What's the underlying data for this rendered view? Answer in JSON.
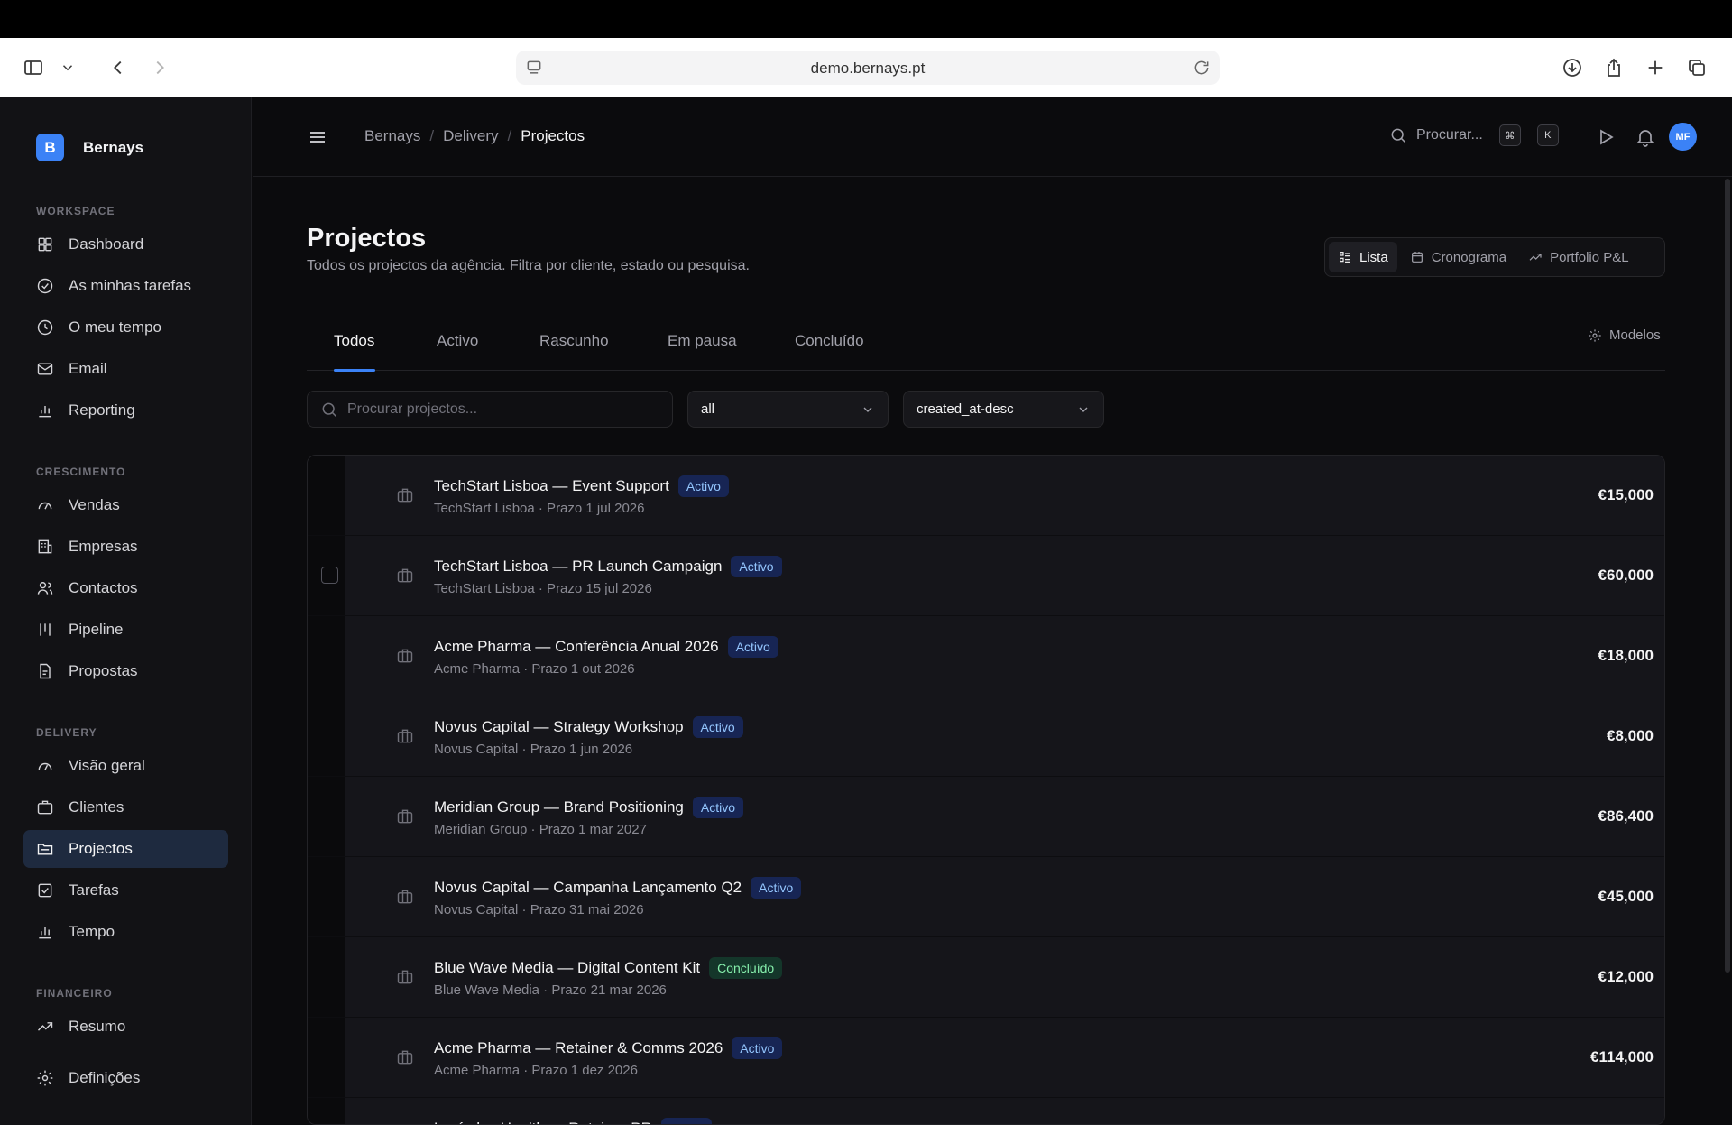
{
  "browser": {
    "url": "demo.bernays.pt"
  },
  "app": {
    "name": "Bernays",
    "logo_letter": "B",
    "avatar_initials": "MF"
  },
  "sidebar": {
    "sections": [
      {
        "title": "WORKSPACE",
        "items": [
          "Dashboard",
          "As minhas tarefas",
          "O meu tempo",
          "Email",
          "Reporting"
        ]
      },
      {
        "title": "CRESCIMENTO",
        "items": [
          "Vendas",
          "Empresas",
          "Contactos",
          "Pipeline",
          "Propostas"
        ]
      },
      {
        "title": "DELIVERY",
        "items": [
          "Visão geral",
          "Clientes",
          "Projectos",
          "Tarefas",
          "Tempo"
        ]
      },
      {
        "title": "FINANCEIRO",
        "items": [
          "Resumo",
          "Definições"
        ]
      }
    ],
    "active": "Projectos"
  },
  "topbar": {
    "breadcrumb": [
      "Bernays",
      "Delivery",
      "Projectos"
    ],
    "search_label": "Procurar...",
    "kbd1": "⌘",
    "kbd2": "K"
  },
  "page": {
    "title": "Projectos",
    "subtitle": "Todos os projectos da agência. Filtra por cliente, estado ou pesquisa.",
    "views": [
      "Lista",
      "Cronograma",
      "Portfolio P&L"
    ],
    "active_view": "Lista",
    "tabs": [
      "Todos",
      "Activo",
      "Rascunho",
      "Em pausa",
      "Concluído"
    ],
    "active_tab": "Todos",
    "models_label": "Modelos",
    "search_placeholder": "Procurar projectos...",
    "filter_status": "all",
    "sort": "created_at-desc"
  },
  "projects": [
    {
      "title": "TechStart Lisboa — Event Support",
      "status": "Activo",
      "meta": "TechStart Lisboa · Prazo 1 jul 2026",
      "amount": "€15,000"
    },
    {
      "title": "TechStart Lisboa — PR Launch Campaign",
      "status": "Activo",
      "meta": "TechStart Lisboa · Prazo 15 jul 2026",
      "amount": "€60,000"
    },
    {
      "title": "Acme Pharma — Conferência Anual 2026",
      "status": "Activo",
      "meta": "Acme Pharma · Prazo 1 out 2026",
      "amount": "€18,000"
    },
    {
      "title": "Novus Capital — Strategy Workshop",
      "status": "Activo",
      "meta": "Novus Capital · Prazo 1 jun 2026",
      "amount": "€8,000"
    },
    {
      "title": "Meridian Group — Brand Positioning",
      "status": "Activo",
      "meta": "Meridian Group · Prazo 1 mar 2027",
      "amount": "€86,400"
    },
    {
      "title": "Novus Capital — Campanha Lançamento Q2",
      "status": "Activo",
      "meta": "Novus Capital · Prazo 31 mai 2026",
      "amount": "€45,000"
    },
    {
      "title": "Blue Wave Media — Digital Content Kit",
      "status": "Concluído",
      "meta": "Blue Wave Media · Prazo 21 mar 2026",
      "amount": "€12,000"
    },
    {
      "title": "Acme Pharma — Retainer & Comms 2026",
      "status": "Activo",
      "meta": "Acme Pharma · Prazo 1 dez 2026",
      "amount": "€114,000"
    },
    {
      "title": "Lusíadas Health — Retainer PR",
      "status": "Activo",
      "meta": "",
      "amount": ""
    }
  ]
}
